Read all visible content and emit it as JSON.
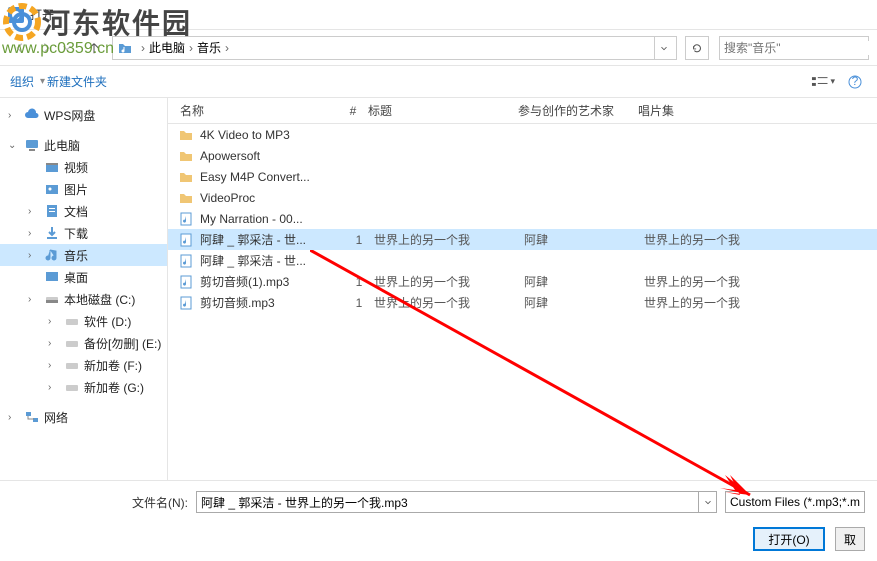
{
  "watermark": {
    "title": "河东软件园",
    "url": "www.pc0359.cn"
  },
  "window": {
    "title": "打开"
  },
  "breadcrumb": {
    "root": "此电脑",
    "folder": "音乐"
  },
  "search": {
    "placeholder": "搜索\"音乐\""
  },
  "toolbar": {
    "organize": "组织",
    "newfolder": "新建文件夹"
  },
  "sidebar": {
    "wps": "WPS网盘",
    "pc": "此电脑",
    "video": "视频",
    "pictures": "图片",
    "docs": "文档",
    "downloads": "下载",
    "music": "音乐",
    "desktop": "桌面",
    "localc": "本地磁盘 (C:)",
    "d": "软件 (D:)",
    "e": "备份[勿删] (E:)",
    "f": "新加卷 (F:)",
    "g": "新加卷 (G:)",
    "network": "网络"
  },
  "columns": {
    "name": "名称",
    "num": "#",
    "title": "标题",
    "artist": "参与创作的艺术家",
    "album": "唱片集"
  },
  "rows": [
    {
      "type": "folder",
      "name": "4K Video to MP3"
    },
    {
      "type": "folder",
      "name": "Apowersoft"
    },
    {
      "type": "folder",
      "name": "Easy M4P Convert..."
    },
    {
      "type": "folder",
      "name": "VideoProc"
    },
    {
      "type": "file",
      "name": "My Narration - 00..."
    },
    {
      "type": "file",
      "name": "阿肆 _ 郭采洁 - 世...",
      "num": "1",
      "title": "世界上的另一个我",
      "artist": "阿肆",
      "album": "世界上的另一个我",
      "selected": true
    },
    {
      "type": "file",
      "name": "阿肆 _ 郭采洁 - 世..."
    },
    {
      "type": "file",
      "name": "剪切音频(1).mp3",
      "num": "1",
      "title": "世界上的另一个我",
      "artist": "阿肆",
      "album": "世界上的另一个我"
    },
    {
      "type": "file",
      "name": "剪切音频.mp3",
      "num": "1",
      "title": "世界上的另一个我",
      "artist": "阿肆",
      "album": "世界上的另一个我"
    }
  ],
  "filename": {
    "label": "文件名(N):",
    "value": "阿肆 _ 郭采洁 - 世界上的另一个我.mp3"
  },
  "filter": "Custom Files (*.mp3;*.m",
  "buttons": {
    "open": "打开(O)",
    "cancel": "取"
  }
}
